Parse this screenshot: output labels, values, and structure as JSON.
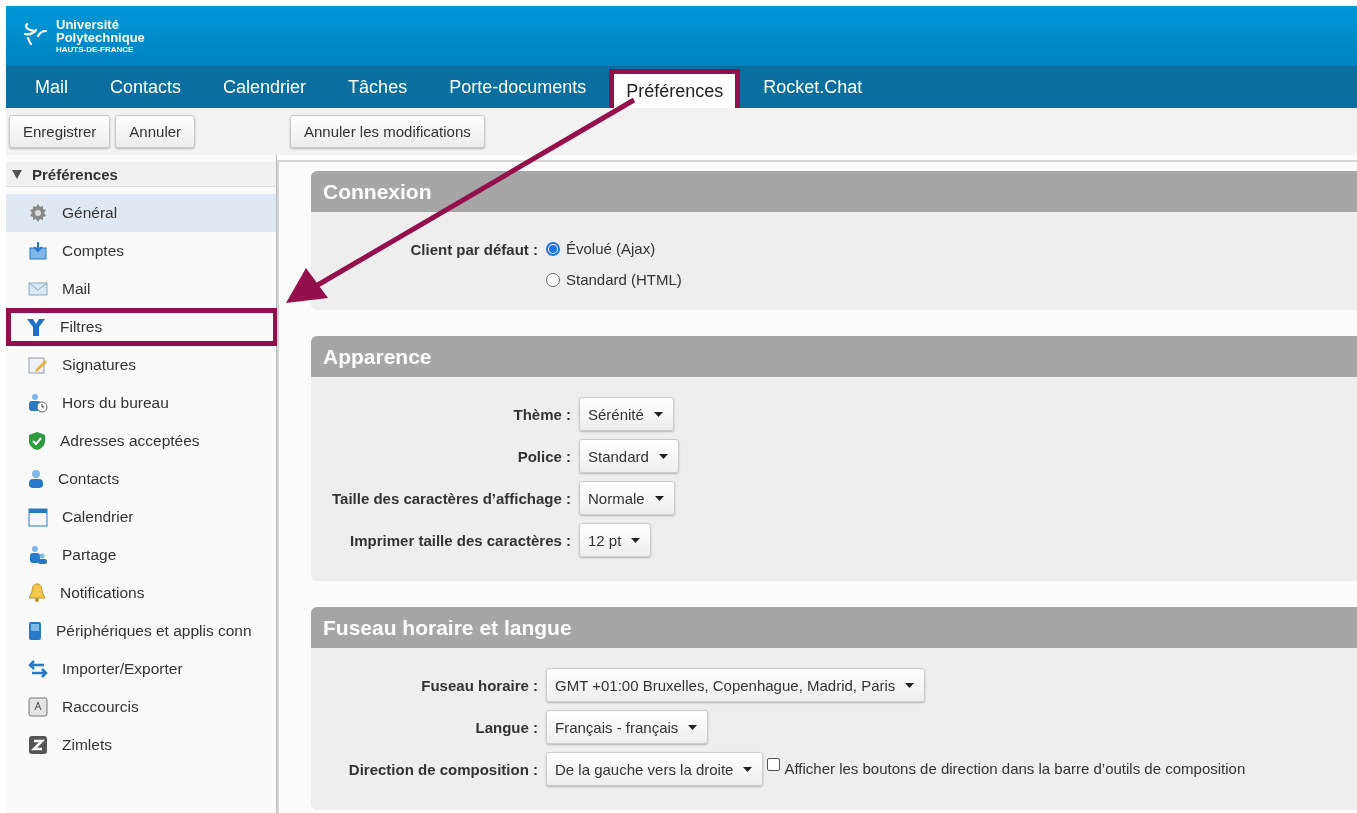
{
  "logo": {
    "line1": "Université",
    "line2": "Polytechnique",
    "line3": "HAUTS-DE-FRANCE"
  },
  "tabs": [
    {
      "label": "Mail",
      "selected": false,
      "highlighted": false
    },
    {
      "label": "Contacts",
      "selected": false,
      "highlighted": false
    },
    {
      "label": "Calendrier",
      "selected": false,
      "highlighted": false
    },
    {
      "label": "Tâches",
      "selected": false,
      "highlighted": false
    },
    {
      "label": "Porte-documents",
      "selected": false,
      "highlighted": false
    },
    {
      "label": "Préférences",
      "selected": true,
      "highlighted": true
    },
    {
      "label": "Rocket.Chat",
      "selected": false,
      "highlighted": false
    }
  ],
  "toolbar_left": [
    "Enregistrer",
    "Annuler"
  ],
  "toolbar_right": [
    "Annuler les modifications"
  ],
  "sidebar": {
    "title": "Préférences",
    "expanded": true,
    "items": [
      {
        "label": "Général",
        "selected": true,
        "highlighted": false
      },
      {
        "label": "Comptes",
        "selected": false,
        "highlighted": false
      },
      {
        "label": "Mail",
        "selected": false,
        "highlighted": false
      },
      {
        "label": "Filtres",
        "selected": false,
        "highlighted": true
      },
      {
        "label": "Signatures",
        "selected": false,
        "highlighted": false
      },
      {
        "label": "Hors du bureau",
        "selected": false,
        "highlighted": false
      },
      {
        "label": "Adresses acceptées",
        "selected": false,
        "highlighted": false
      },
      {
        "label": "Contacts",
        "selected": false,
        "highlighted": false
      },
      {
        "label": "Calendrier",
        "selected": false,
        "highlighted": false
      },
      {
        "label": "Partage",
        "selected": false,
        "highlighted": false
      },
      {
        "label": "Notifications",
        "selected": false,
        "highlighted": false
      },
      {
        "label": "Périphériques et applis conn",
        "selected": false,
        "highlighted": false
      },
      {
        "label": "Importer/Exporter",
        "selected": false,
        "highlighted": false
      },
      {
        "label": "Raccourcis",
        "selected": false,
        "highlighted": false
      },
      {
        "label": "Zimlets",
        "selected": false,
        "highlighted": false
      }
    ]
  },
  "sections": [
    {
      "title": "Connexion",
      "rows": [
        {
          "kind": "radio",
          "label": "Client par défaut :",
          "options": [
            {
              "label": "Évolué (Ajax)",
              "selected": true
            },
            {
              "label": "Standard (HTML)",
              "selected": false
            }
          ]
        }
      ]
    },
    {
      "title": "Apparence",
      "rows": [
        {
          "kind": "select",
          "label": "Thème :",
          "value": "Sérénité"
        },
        {
          "kind": "select",
          "label": "Police :",
          "value": "Standard"
        },
        {
          "kind": "select",
          "label": "Taille des caractères d’affichage :",
          "value": "Normale"
        },
        {
          "kind": "select",
          "label": "Imprimer taille des caractères :",
          "value": "12 pt"
        }
      ]
    },
    {
      "title": "Fuseau horaire et langue",
      "rows": [
        {
          "kind": "select",
          "label": "Fuseau horaire :",
          "value": "GMT +01:00 Bruxelles, Copenhague, Madrid, Paris"
        },
        {
          "kind": "select",
          "label": "Langue :",
          "value": "Français - français"
        },
        {
          "kind": "select",
          "label": "Direction de composition :",
          "value": "De la gauche vers la droite",
          "checkbox": {
            "label": "Afficher les boutons de direction dans la barre d’outils de composition",
            "checked": false
          }
        }
      ]
    }
  ],
  "annotation": {
    "arrow": true
  }
}
